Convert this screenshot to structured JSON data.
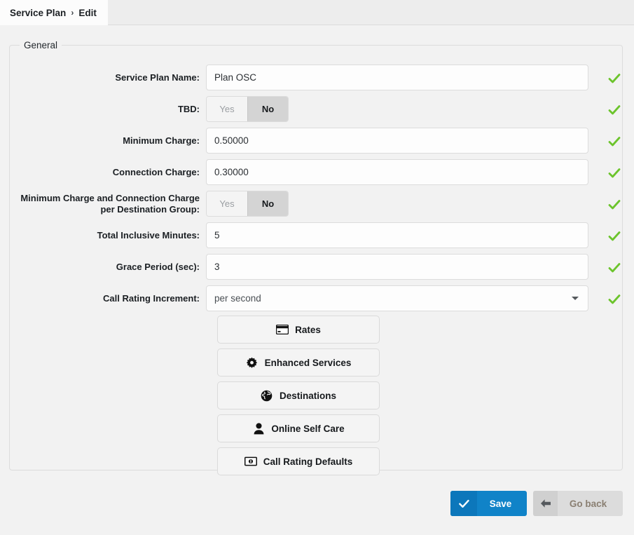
{
  "breadcrumb": {
    "root": "Service Plan",
    "separator": "›",
    "current": "Edit"
  },
  "fieldset": {
    "legend": "General"
  },
  "colors": {
    "accent_blue": "#1083c8",
    "accent_blue_dark": "#0c77bb",
    "valid_green": "#6cc42c",
    "page_background": "#f2f2f2",
    "toggle_selected": "#d4d4d4"
  },
  "form": {
    "rows": [
      {
        "label": "Service Plan Name:",
        "type": "text",
        "value": "Plan OSC",
        "placeholder": "",
        "valid": true,
        "name": "service-plan-name"
      },
      {
        "label": "TBD:",
        "type": "toggle",
        "options": [
          "Yes",
          "No"
        ],
        "value": "No",
        "valid": true,
        "name": "tbd"
      },
      {
        "label": "Minimum Charge:",
        "type": "text",
        "value": "0.50000",
        "placeholder": "",
        "valid": true,
        "name": "minimum-charge"
      },
      {
        "label": "Connection Charge:",
        "type": "text",
        "value": "0.30000",
        "placeholder": "",
        "valid": true,
        "name": "connection-charge"
      },
      {
        "label": "Minimum Charge and Connection Charge\nper Destination Group:",
        "type": "toggle",
        "options": [
          "Yes",
          "No"
        ],
        "value": "No",
        "valid": true,
        "name": "min-conn-charge-per-destination-group"
      },
      {
        "label": "Total Inclusive Minutes:",
        "type": "text",
        "value": "5",
        "placeholder": "",
        "valid": true,
        "name": "total-inclusive-minutes"
      },
      {
        "label": "Grace Period (sec):",
        "type": "text",
        "value": "3",
        "placeholder": "",
        "valid": true,
        "name": "grace-period-sec"
      },
      {
        "label": "Call Rating Increment:",
        "type": "select",
        "value": "per second",
        "valid": true,
        "name": "call-rating-increment"
      }
    ]
  },
  "action_buttons": [
    {
      "label": "Rates",
      "icon": "credit-card-icon",
      "name": "rates"
    },
    {
      "label": "Enhanced Services",
      "icon": "gear-icon",
      "name": "enhanced-services"
    },
    {
      "label": "Destinations",
      "icon": "globe-icon",
      "name": "destinations"
    },
    {
      "label": "Online Self Care",
      "icon": "user-icon",
      "name": "online-self-care"
    },
    {
      "label": "Call Rating Defaults",
      "icon": "banknote-icon",
      "name": "call-rating-defaults"
    }
  ],
  "footer": {
    "save_label": "Save",
    "save_icon": "check-icon",
    "goback_label": "Go back",
    "goback_icon": "arrow-left-icon"
  }
}
